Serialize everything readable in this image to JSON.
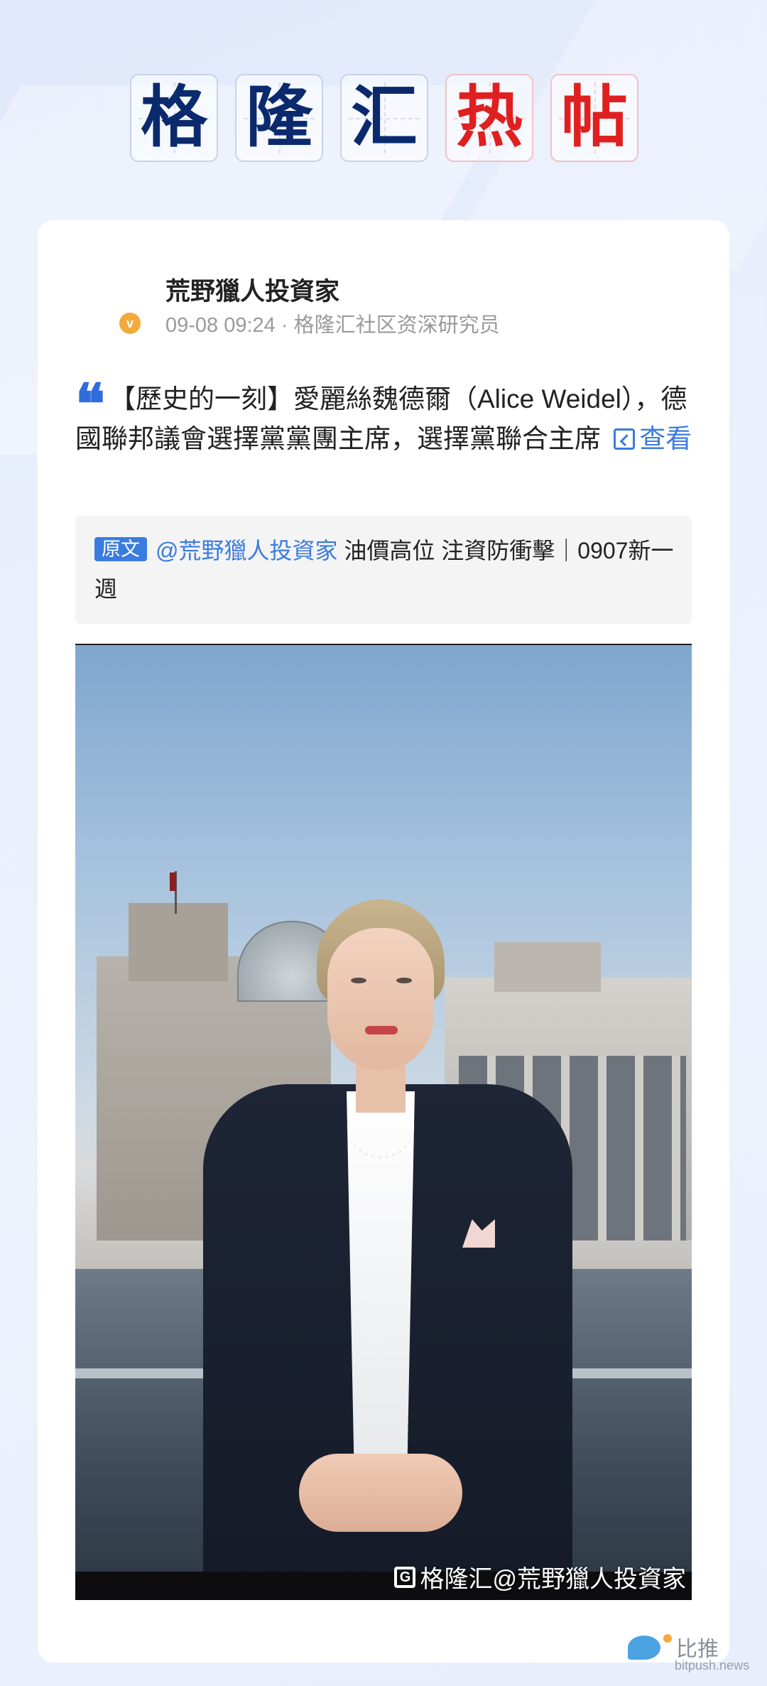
{
  "header": {
    "title_chars": [
      "格",
      "隆",
      "汇",
      "热",
      "帖"
    ],
    "accent_color": "#0b2a6e",
    "hot_color": "#e02020"
  },
  "post": {
    "author": "荒野獵人投資家",
    "meta": "09-08 09:24 · 格隆汇社区资深研究员",
    "verify_badge": "v",
    "quote_icon": "❝",
    "body": "【歷史的一刻】愛麗絲魏德爾（Alice Weidel），德國聯邦議會選擇黨黨團主席，選擇黨聯合主席",
    "view_label": "查看"
  },
  "source": {
    "badge": "原文",
    "handle": "@荒野獵人投資家",
    "title": " 油價高位 注資防衝擊｜0907新一週"
  },
  "photo": {
    "watermark_logo": "G",
    "watermark_text": "格隆汇@荒野獵人投資家"
  },
  "brand": {
    "name_cn": "比推",
    "name_en": "bitpush.news",
    "color": "#4aa3e0"
  }
}
